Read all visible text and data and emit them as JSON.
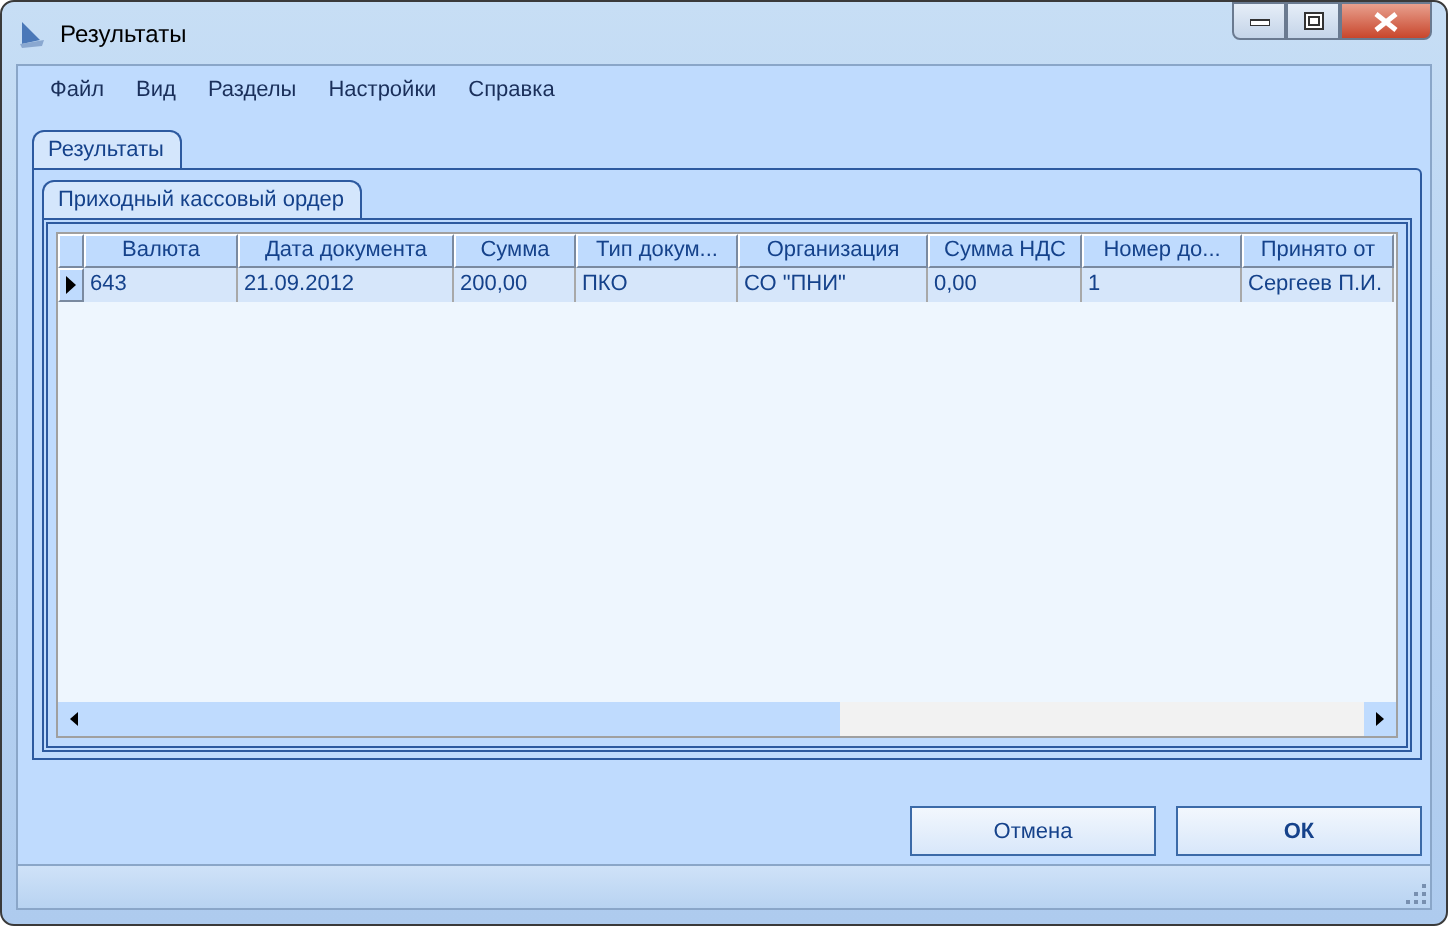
{
  "window": {
    "title": "Результаты"
  },
  "menu": [
    "Файл",
    "Вид",
    "Разделы",
    "Настройки",
    "Справка"
  ],
  "outer_tabs": [
    {
      "label": "Результаты",
      "selected": true
    }
  ],
  "inner_tabs": [
    {
      "label": "Приходный кассовый ордер",
      "selected": true
    }
  ],
  "table": {
    "columns": [
      "Валюта",
      "Дата документа",
      "Сумма",
      "Тип докум...",
      "Организация",
      "Сумма НДС",
      "Номер до...",
      "Принято от"
    ],
    "rows": [
      {
        "current": true,
        "cells": [
          "643",
          "21.09.2012",
          "200,00",
          "ПКО",
          "СО \"ПНИ\"",
          "0,00",
          "1",
          "Сергеев П.И."
        ]
      }
    ]
  },
  "buttons": [
    {
      "label": "Отмена",
      "default": false
    },
    {
      "label": "ОК",
      "default": true
    }
  ]
}
